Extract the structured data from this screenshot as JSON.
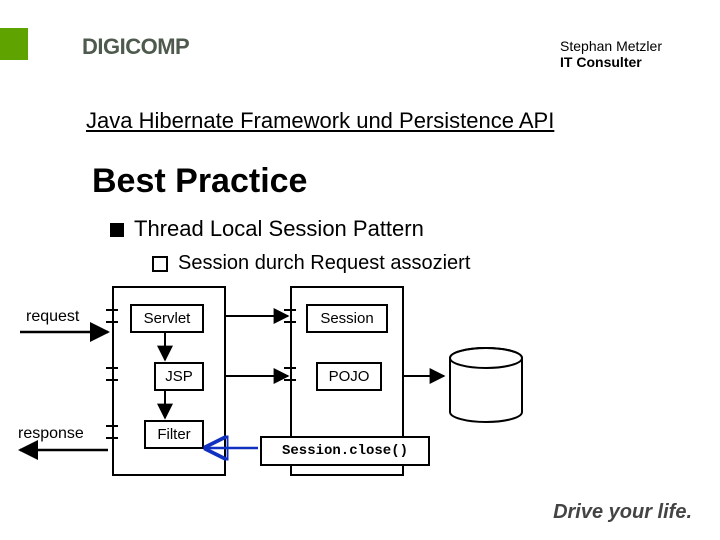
{
  "brand": "DIGICOMP",
  "author": {
    "name": "Stephan Metzler",
    "role": "IT Consulter"
  },
  "topic": "Java Hibernate Framework und Persistence API",
  "title": "Best Practice",
  "bullets": {
    "b1": "Thread Local Session Pattern",
    "b2": "Session durch Request assoziert"
  },
  "labels": {
    "request": "request",
    "response": "response",
    "servlet": "Servlet",
    "jsp": "JSP",
    "filter": "Filter",
    "session": "Session",
    "pojo": "POJO",
    "close": "Session.close()"
  },
  "tagline": "Drive your life."
}
